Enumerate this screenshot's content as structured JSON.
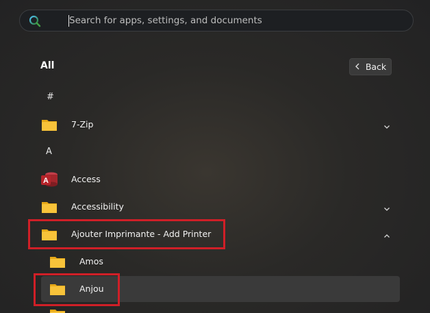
{
  "search": {
    "placeholder": "Search for apps, settings, and documents",
    "value": ""
  },
  "list": {
    "heading": "All",
    "back_label": "Back",
    "sections": [
      {
        "letter": "#"
      },
      {
        "letter": "A"
      }
    ],
    "apps": [
      {
        "label": "7-Zip",
        "icon": "folder-icon",
        "expandable": true,
        "expanded": false
      },
      {
        "label": "Access",
        "icon": "access-app-icon",
        "expandable": false
      },
      {
        "label": "Accessibility",
        "icon": "folder-icon",
        "expandable": true,
        "expanded": false
      },
      {
        "label": "Ajouter Imprimante - Add Printer",
        "icon": "folder-icon",
        "expandable": true,
        "expanded": true
      },
      {
        "label": "Amos",
        "icon": "folder-icon",
        "expandable": false,
        "nested": true
      },
      {
        "label": "Anjou",
        "icon": "folder-icon",
        "expandable": false,
        "nested": true,
        "hovered": true
      }
    ]
  },
  "colors": {
    "highlight_box": "#d01f27",
    "folder_yellow": "#f8c33a",
    "access_red": "#b7242a"
  }
}
